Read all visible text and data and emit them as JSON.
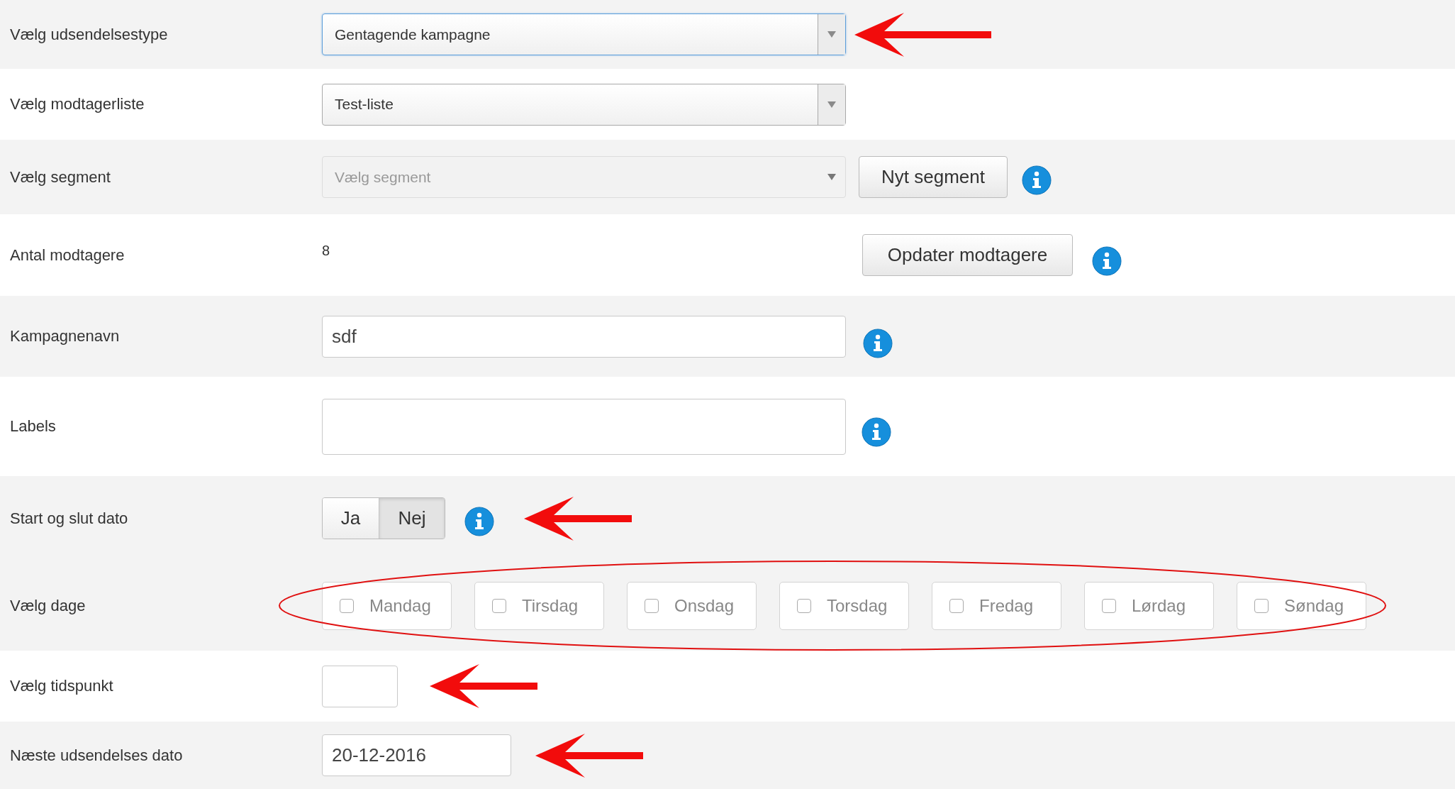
{
  "rows": [
    {
      "label": "Vælg udsendelsestype",
      "kind": "select",
      "shaded": true,
      "value": "Gentagende kampagne",
      "focused": true,
      "arrow": true
    },
    {
      "label": "Vælg modtagerliste",
      "kind": "select",
      "shaded": false,
      "value": "Test-liste",
      "focused": false
    },
    {
      "label": "Vælg segment",
      "kind": "select",
      "shaded": true,
      "placeholder": "Vælg segment",
      "disabled": true,
      "button": "Nyt segment",
      "info": true
    },
    {
      "label": "Antal modtagere",
      "kind": "count",
      "shaded": false,
      "value": "8",
      "button": "Opdater modtagere",
      "info": true
    },
    {
      "label": "Kampagnenavn",
      "kind": "input",
      "shaded": true,
      "value": "sdf",
      "info": true
    },
    {
      "label": "Labels",
      "kind": "textarea",
      "shaded": false,
      "info": true
    },
    {
      "label": "Start og slut dato",
      "kind": "toggle",
      "shaded": true,
      "options": [
        {
          "label": "Ja",
          "selected": false
        },
        {
          "label": "Nej",
          "selected": true
        }
      ],
      "info": true,
      "arrow": true
    },
    {
      "label": "Vælg dage",
      "kind": "days",
      "shaded": true,
      "circled": true,
      "days": [
        {
          "label": "Mandag",
          "checked": false
        },
        {
          "label": "Tirsdag",
          "checked": false
        },
        {
          "label": "Onsdag",
          "checked": false
        },
        {
          "label": "Torsdag",
          "checked": false
        },
        {
          "label": "Fredag",
          "checked": false
        },
        {
          "label": "Lørdag",
          "checked": false
        },
        {
          "label": "Søndag",
          "checked": false
        }
      ]
    },
    {
      "label": "Vælg tidspunkt",
      "kind": "time",
      "shaded": false,
      "arrow": true
    },
    {
      "label": "Næste udsendelses dato",
      "kind": "date",
      "shaded": true,
      "value": "20-12-2016",
      "arrow": true
    }
  ]
}
